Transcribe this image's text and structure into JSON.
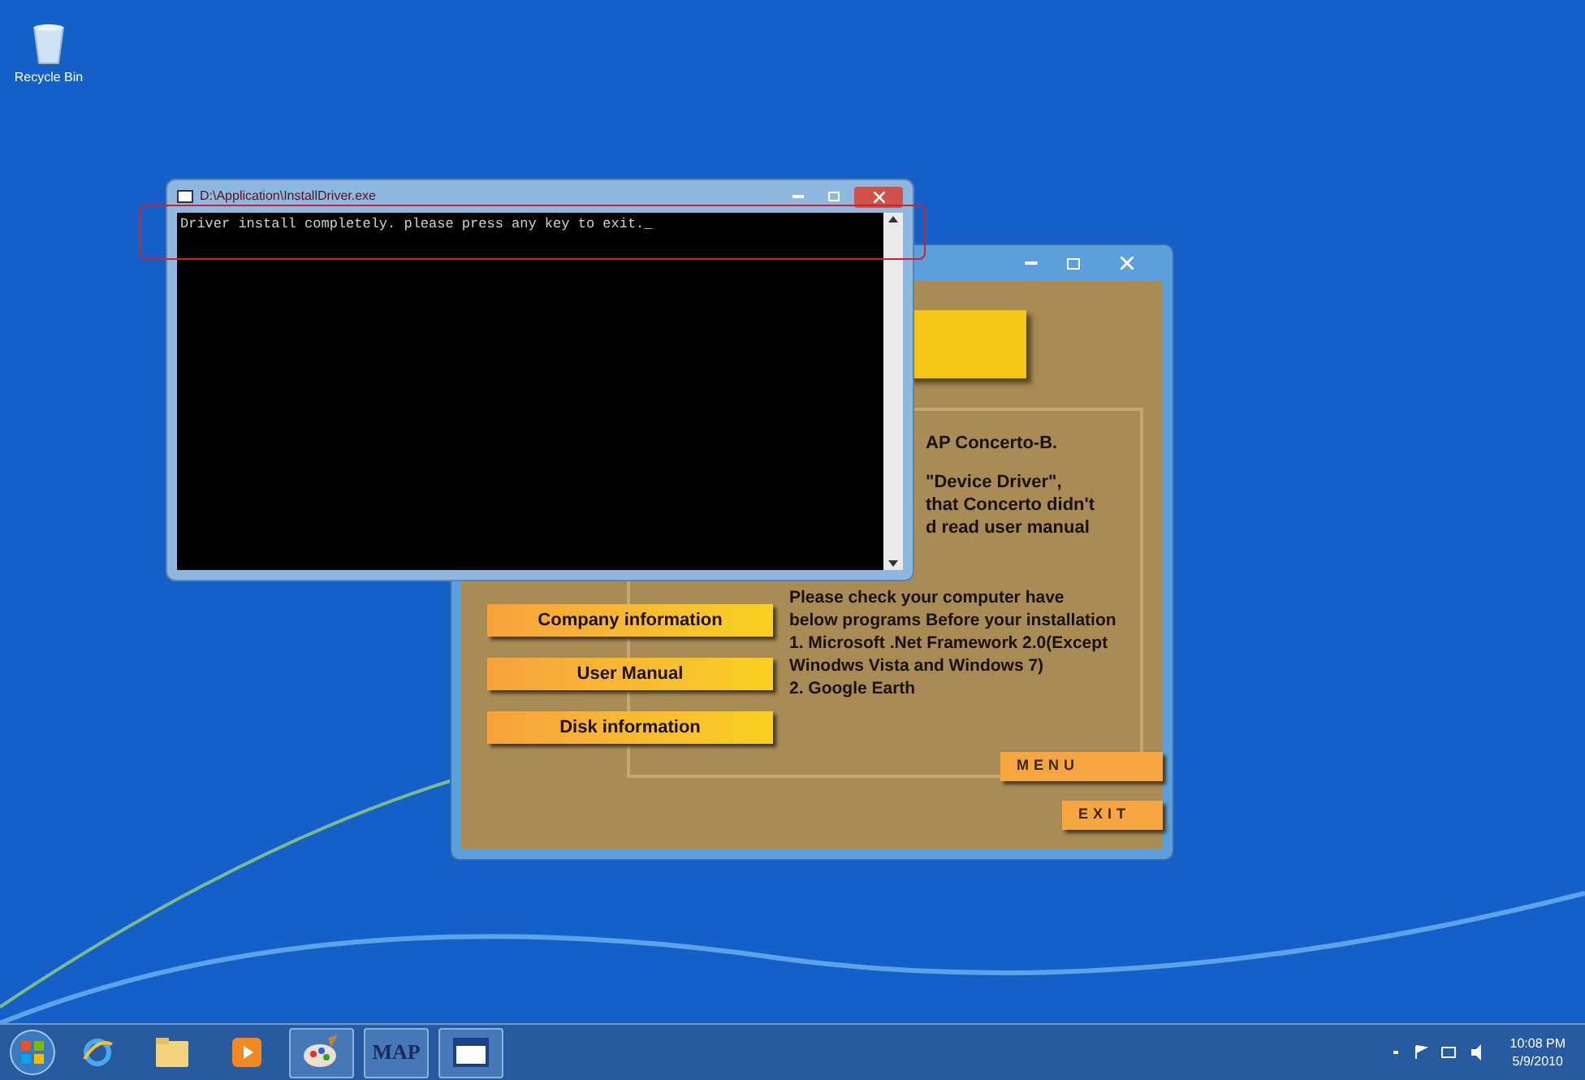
{
  "desktop": {
    "icons": [
      {
        "label": "Recycle Bin"
      }
    ]
  },
  "console_window": {
    "title": "D:\\Application\\InstallDriver.exe",
    "lines": [
      "Driver install completely. please press any key to exit."
    ],
    "cursor": "_"
  },
  "app_window": {
    "info_lines": [
      "AP Concerto-B.",
      "\"Device Driver\",",
      "that Concerto didn't",
      "d read user manual"
    ],
    "requirements": [
      "Please check your computer have",
      "below programs Before your installation",
      "1. Microsoft .Net Framework 2.0(Except",
      "Winodws Vista and Windows 7)",
      "2. Google Earth"
    ],
    "buttons": [
      "Company information",
      "User Manual",
      "Disk information"
    ],
    "nav_buttons": [
      "MENU",
      "EXIT"
    ]
  },
  "taskbar": {
    "apps": [
      {
        "kind": "ie"
      },
      {
        "kind": "folder"
      },
      {
        "kind": "media"
      },
      {
        "kind": "paint"
      },
      {
        "kind": "text",
        "label": "MAP"
      },
      {
        "kind": "window"
      }
    ],
    "clock": {
      "time": "10:08 PM",
      "date": "5/9/2010"
    }
  }
}
